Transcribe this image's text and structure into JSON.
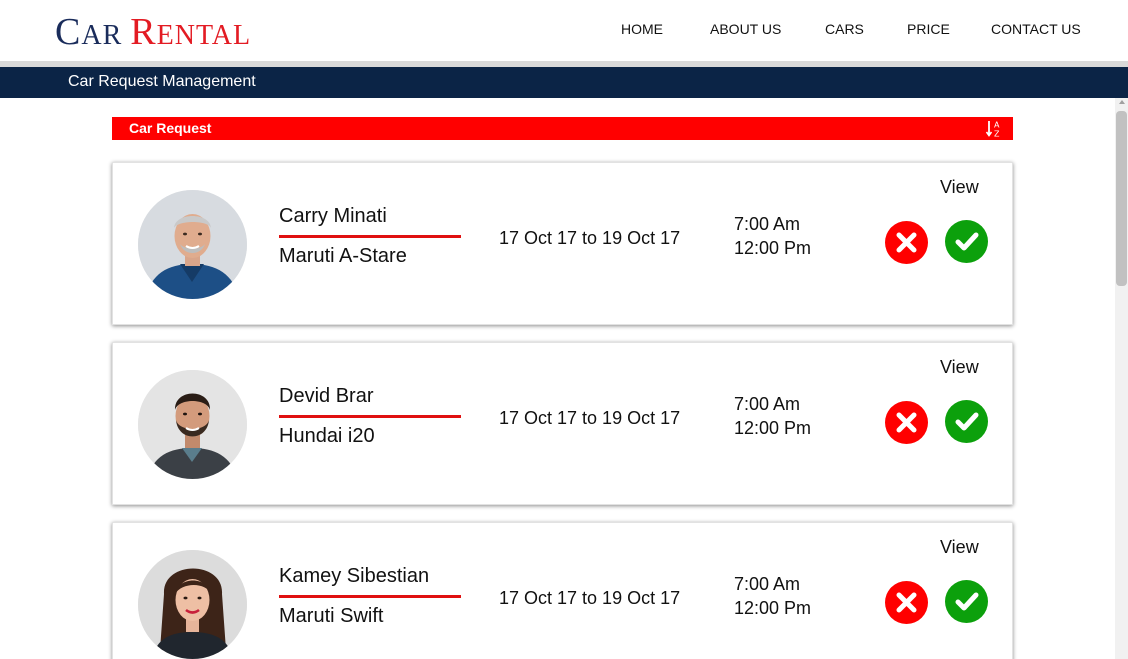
{
  "brand": {
    "word1_initial": "C",
    "word1_rest": "AR",
    "word2_initial": "R",
    "word2_rest": "ENTAL",
    "color_primary": "#1a2c5b",
    "color_accent": "#e31b23"
  },
  "nav": {
    "home": "HOME",
    "about": "ABOUT US",
    "cars": "CARS",
    "price": "PRICE",
    "contact": "CONTACT US"
  },
  "page_title": "Car Request Management",
  "section": {
    "title": "Car Request",
    "sort_icon": "sort-alpha-icon"
  },
  "requests": [
    {
      "name": "Carry Minati",
      "car": "Maruti A-Stare",
      "dates": "17 Oct 17 to 19 Oct 17",
      "time_start": "7:00 Am",
      "time_end": "12:00 Pm",
      "view": "View"
    },
    {
      "name": "Devid Brar",
      "car": "Hundai i20",
      "dates": "17 Oct 17 to 19 Oct 17",
      "time_start": "7:00 Am",
      "time_end": "12:00 Pm",
      "view": "View"
    },
    {
      "name": "Kamey Sibestian",
      "car": "Maruti Swift",
      "dates": "17 Oct 17 to 19 Oct 17",
      "time_start": "7:00 Am",
      "time_end": "12:00 Pm",
      "view": "View"
    }
  ],
  "colors": {
    "header_bar": "#0b2446",
    "section_bar": "#ff0000",
    "reject": "#ff0000",
    "accept": "#0ca00c"
  }
}
